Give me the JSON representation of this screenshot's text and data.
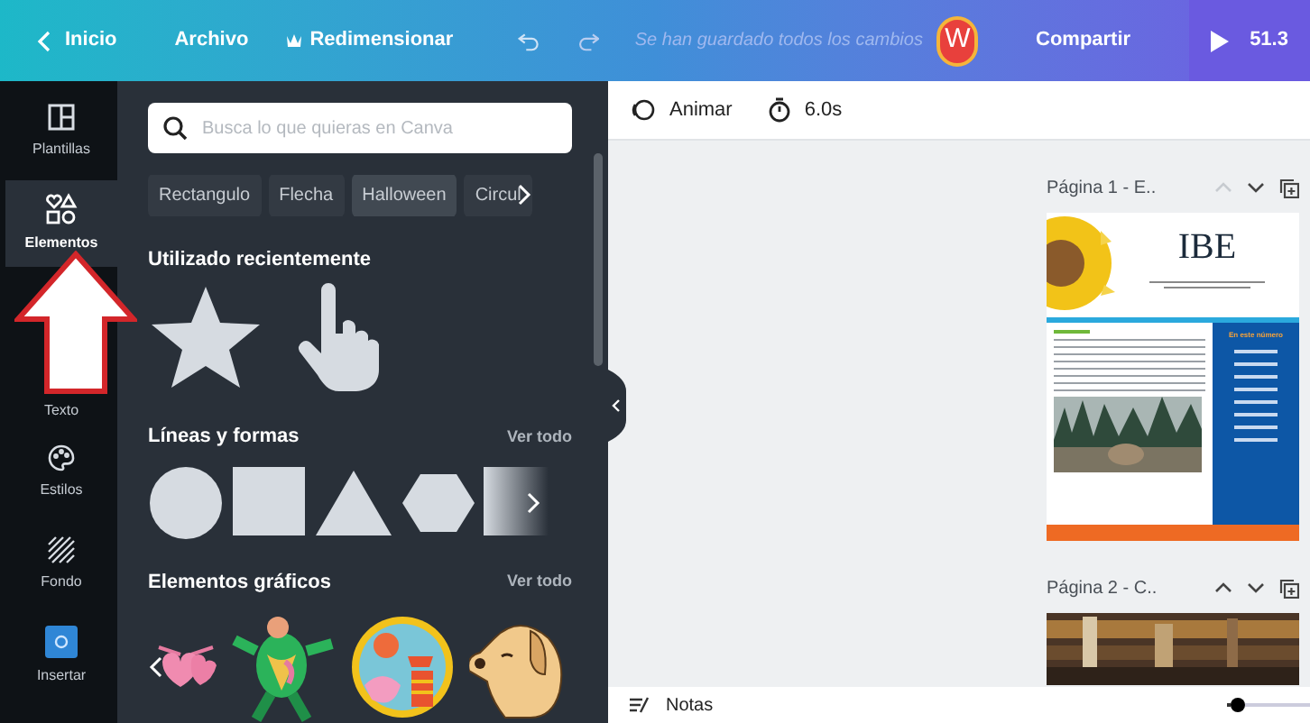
{
  "topbar": {
    "back": "Inicio",
    "menu": [
      "Archivo",
      "Redimensionar"
    ],
    "save_status": "Se han guardado todos los cambios",
    "avatar": "W",
    "share": "Compartir",
    "present": "51.3"
  },
  "sidebar": {
    "items": [
      {
        "label": "Plantillas",
        "kind": "templates",
        "selected": false
      },
      {
        "label": "Elementos",
        "kind": "elements",
        "selected": true
      },
      {
        "label": "Texto",
        "kind": "text",
        "selected": false
      },
      {
        "label": "Estilos",
        "kind": "styles",
        "selected": false
      },
      {
        "label": "Fondo",
        "kind": "background",
        "selected": false
      },
      {
        "label": "Insertar",
        "kind": "insert",
        "selected": false
      }
    ]
  },
  "panel": {
    "search": {
      "placeholder": "Busca lo que quieras en Canva"
    },
    "chips": [
      {
        "label": "Rectangulo",
        "selected": false
      },
      {
        "label": "Flecha",
        "selected": false
      },
      {
        "label": "Halloween",
        "selected": true
      },
      {
        "label": "Circul",
        "selected": false
      }
    ],
    "sections": [
      {
        "title": "Utilizado recientemente",
        "kind": "recent"
      },
      {
        "title": "Líneas y formas",
        "kind": "shapes",
        "link": "Ver todo"
      },
      {
        "title": "Elementos gráficos",
        "kind": "graphics",
        "link": "Ver todo"
      }
    ]
  },
  "toolbar": {
    "animate": "Animar",
    "duration": "6.0s"
  },
  "pages": [
    {
      "title": "Página 1 - E..",
      "heading": "IBE",
      "sidebar_title": "En este número"
    },
    {
      "title": "Página 2 - C.."
    }
  ],
  "notes": "Notas",
  "zoom": {
    "level": 0.05
  }
}
